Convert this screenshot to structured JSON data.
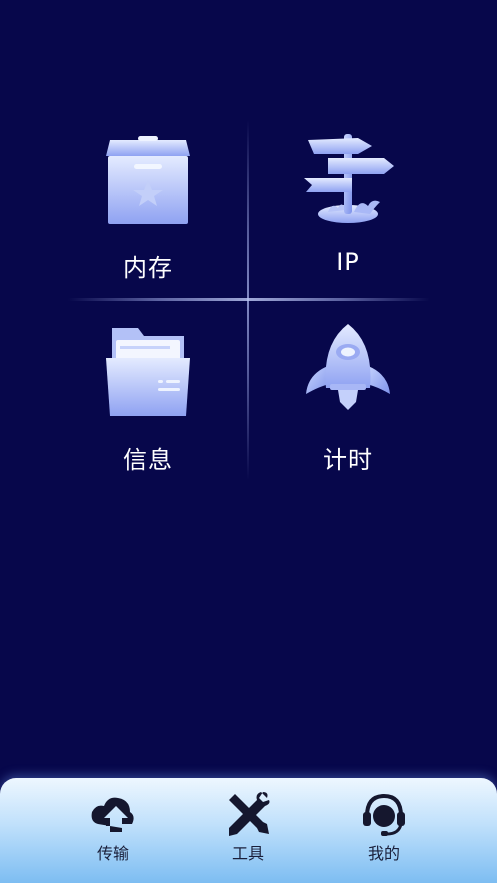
{
  "grid": {
    "tiles": [
      {
        "label": "内存",
        "icon": "storage-box-icon"
      },
      {
        "label": "IP",
        "icon": "signpost-icon"
      },
      {
        "label": "信息",
        "icon": "folder-icon"
      },
      {
        "label": "计时",
        "icon": "rocket-icon"
      }
    ]
  },
  "bottom_nav": {
    "items": [
      {
        "label": "传输",
        "icon": "cloud-upload-icon"
      },
      {
        "label": "工具",
        "icon": "tools-icon"
      },
      {
        "label": "我的",
        "icon": "headset-user-icon"
      }
    ]
  },
  "colors": {
    "background": "#07074b",
    "icon_light": "#dce6ff",
    "icon_mid": "#93a6f4",
    "nav_top": "#eef7ff",
    "nav_bottom": "#7dbdf2",
    "nav_icon": "#15172e"
  }
}
